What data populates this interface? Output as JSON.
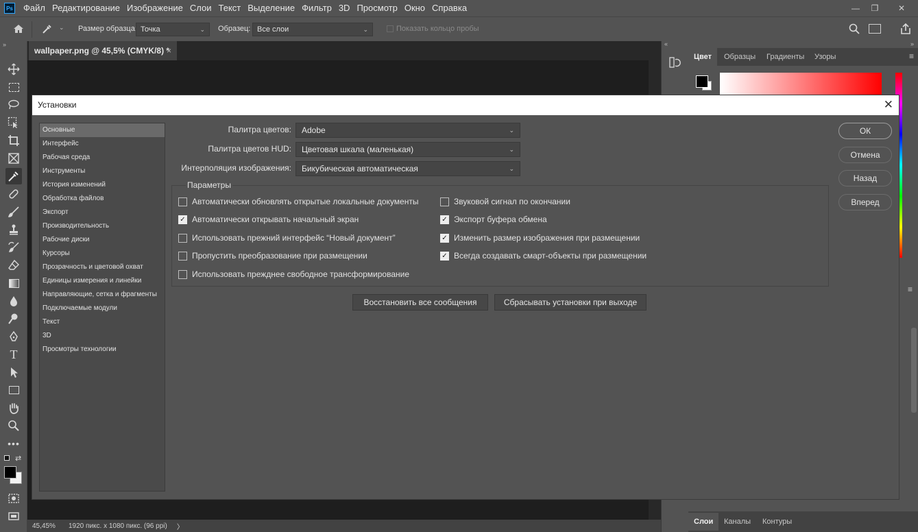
{
  "menu": {
    "logo": "Ps",
    "items": [
      "Файл",
      "Редактирование",
      "Изображение",
      "Слои",
      "Текст",
      "Выделение",
      "Фильтр",
      "3D",
      "Просмотр",
      "Окно",
      "Справка"
    ]
  },
  "window_controls": {
    "minimize": "—",
    "restore": "❐",
    "close": "✕"
  },
  "options_bar": {
    "sample_size_label": "Размер образца:",
    "sample_size_value": "Точка",
    "sample_label": "Образец:",
    "sample_value": "Все слои",
    "show_ring_label": "Показать кольцо пробы"
  },
  "document_tab": {
    "title": "wallpaper.png @ 45,5% (CMYK/8) *",
    "close": "×"
  },
  "status_bar": {
    "zoom": "45,45%",
    "info": "1920 пикс. x 1080 пикс. (96 ppi)",
    "arrow": "〉"
  },
  "right_panel": {
    "top_tabs": [
      "Цвет",
      "Образцы",
      "Градиенты",
      "Узоры"
    ],
    "bottom_tabs": [
      "Слои",
      "Каналы",
      "Контуры"
    ]
  },
  "dialog": {
    "title": "Установки",
    "close": "✕",
    "categories": [
      "Основные",
      "Интерфейс",
      "Рабочая среда",
      "Инструменты",
      "История изменений",
      "Обработка файлов",
      "Экспорт",
      "Производительность",
      "Рабочие диски",
      "Курсоры",
      "Прозрачность и цветовой охват",
      "Единицы измерения и линейки",
      "Направляющие, сетка и фрагменты",
      "Подключаемые модули",
      "Текст",
      "3D",
      "Просмотры технологии"
    ],
    "fields": [
      {
        "label": "Палитра цветов:",
        "value": "Adobe"
      },
      {
        "label": "Палитра цветов HUD:",
        "value": "Цветовая шкала (маленькая)"
      },
      {
        "label": "Интерполяция изображения:",
        "value": "Бикубическая автоматическая"
      }
    ],
    "params_title": "Параметры",
    "options_left": [
      {
        "label": "Автоматически обновлять открытые локальные документы",
        "checked": false
      },
      {
        "label": "Автоматически открывать начальный экран",
        "checked": true
      },
      {
        "label": "Использовать прежний интерфейс “Новый документ”",
        "checked": false
      },
      {
        "label": "Пропустить преобразование при размещении",
        "checked": false
      },
      {
        "label": "Использовать прежднее свободное трансформирование",
        "checked": false
      }
    ],
    "options_right": [
      {
        "label": "Звуковой сигнал по окончании",
        "checked": false
      },
      {
        "label": "Экспорт буфера обмена",
        "checked": true
      },
      {
        "label": "Изменить размер изображения при размещении",
        "checked": true
      },
      {
        "label": "Всегда создавать смарт-объекты при размещении",
        "checked": true
      }
    ],
    "reset_messages_button": "Восстановить все сообщения",
    "reset_prefs_button": "Сбрасывать установки при выходе",
    "buttons": {
      "ok": "ОК",
      "cancel": "Отмена",
      "back": "Назад",
      "forward": "Вперед"
    }
  }
}
